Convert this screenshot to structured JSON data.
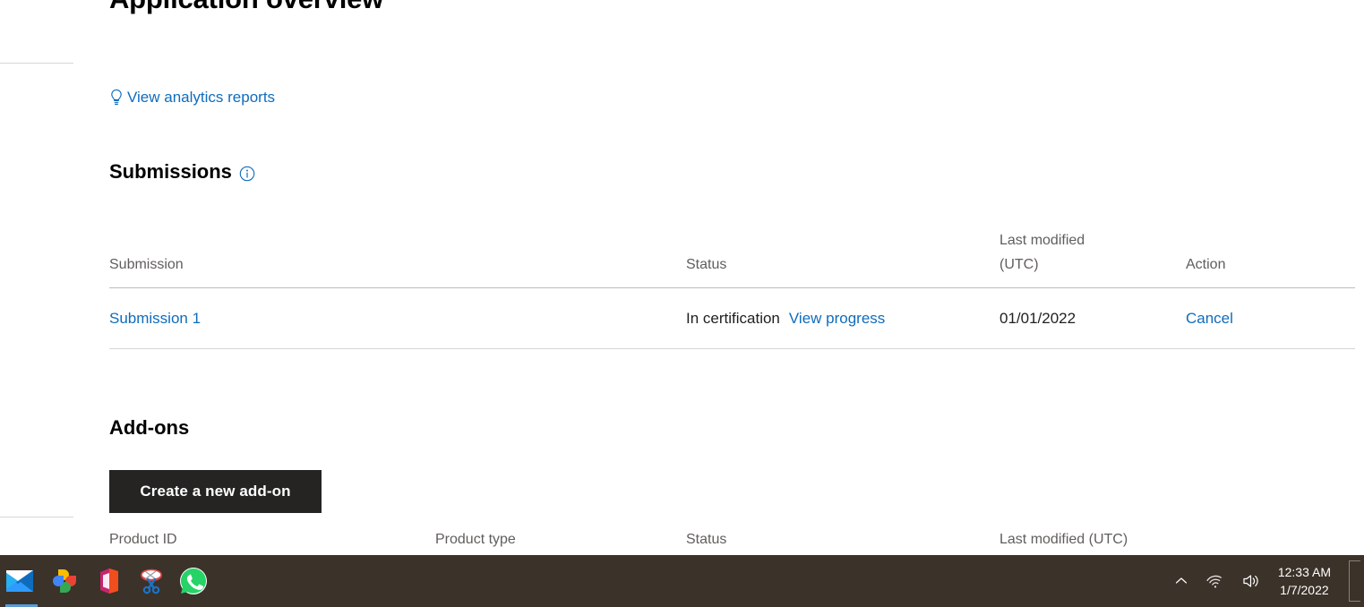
{
  "page": {
    "title": "Application overview",
    "analytics_link": {
      "label": "View analytics reports",
      "icon": "lightbulb-icon"
    }
  },
  "submissions_section": {
    "heading": "Submissions",
    "info_icon": "info-icon",
    "table": {
      "columns": [
        {
          "label": "Submission"
        },
        {
          "label": "Status"
        },
        {
          "label": "Last modified\n(UTC)",
          "line1": "Last modified",
          "line2": "(UTC)"
        },
        {
          "label": "Action"
        }
      ],
      "rows": [
        {
          "submission": "Submission 1",
          "status": "In certification",
          "status_link": "View progress",
          "last_modified": "01/01/2022",
          "action": "Cancel"
        }
      ]
    }
  },
  "addons_section": {
    "heading": "Add-ons",
    "create_button": "Create a new add-on",
    "table": {
      "columns": [
        {
          "label": "Product ID"
        },
        {
          "label": "Product type"
        },
        {
          "label": "Status"
        },
        {
          "label": "Last modified (UTC)"
        }
      ],
      "rows": []
    }
  },
  "taskbar": {
    "apps": [
      {
        "name": "mail-app-icon",
        "label": "Mail"
      },
      {
        "name": "google-photos-app-icon",
        "label": "Google Photos"
      },
      {
        "name": "microsoft-office-app-icon",
        "label": "Microsoft Office"
      },
      {
        "name": "snipping-tool-app-icon",
        "label": "Snipping Tool"
      },
      {
        "name": "whatsapp-app-icon",
        "label": "WhatsApp"
      }
    ],
    "tray": {
      "show_hidden_icons": "chevron-up-icon",
      "network": "wifi-icon",
      "volume": "speaker-icon",
      "time": "12:33 AM",
      "date": "1/7/2022"
    }
  },
  "colors": {
    "link": "#0f6cbd",
    "button_bg": "#252423",
    "taskbar_bg": "#3b322a",
    "text": "#201f1e",
    "muted_text": "#605e5c",
    "border": "#d6d6d6"
  }
}
